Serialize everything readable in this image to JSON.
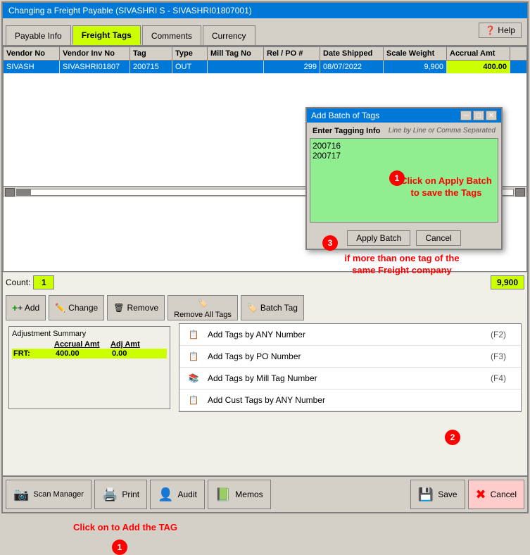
{
  "titleBar": {
    "text": "Changing a Freight Payable  (SIVASHRI S - SIVASHRI01807001)"
  },
  "tabs": [
    {
      "id": "payable-info",
      "label": "Payable Info",
      "active": false
    },
    {
      "id": "freight-tags",
      "label": "Freight Tags",
      "active": true
    },
    {
      "id": "comments",
      "label": "Comments",
      "active": false
    },
    {
      "id": "currency",
      "label": "Currency",
      "active": false
    }
  ],
  "helpBtn": "❓ Help",
  "table": {
    "headers": [
      "Vendor No",
      "Vendor Inv No",
      "Tag",
      "Type",
      "Mill Tag No",
      "Rel / PO #",
      "Date Shipped",
      "Scale Weight",
      "Accrual Amt"
    ],
    "rows": [
      {
        "vendorNo": "SIVASH",
        "vendorInvNo": "SIVASHRI01807",
        "tag": "200715",
        "type": "OUT",
        "millTagNo": "",
        "relPo": "299",
        "dateShipped": "08/07/2022",
        "scaleWeight": "9,900",
        "accrualAmt": "400.00",
        "selected": true
      }
    ]
  },
  "count": {
    "label": "Count:",
    "value": "1"
  },
  "total": "9,900",
  "buttons": {
    "add": "+ Add",
    "change": "Change",
    "remove": "Remove",
    "removeAll": "Remove All Tags",
    "batchTag": "Batch Tag"
  },
  "dropdownItems": [
    {
      "label": "Add Tags by ANY Number",
      "shortcut": "(F2)"
    },
    {
      "label": "Add Tags by PO Number",
      "shortcut": "(F3)"
    },
    {
      "label": "Add Tags by Mill Tag Number",
      "shortcut": "(F4)"
    },
    {
      "label": "Add Cust Tags by ANY Number",
      "shortcut": ""
    }
  ],
  "adjustmentSummary": {
    "title": "Adjustment Summary",
    "headers": [
      "",
      "Accrual Amt",
      "Adj Amt"
    ],
    "rows": [
      {
        "label": "FRT:",
        "accrual": "400.00",
        "adj": "0.00",
        "highlight": true
      }
    ]
  },
  "annotations": {
    "clickToAdd": "Click on to Add the TAG",
    "clickApply": "Click on Apply Batch to save the Tags",
    "moreTags": "if more than one tag of the same Freight company"
  },
  "modal": {
    "title": "Add Batch of Tags",
    "labelEnter": "Enter Tagging Info",
    "labelHint": "Line by Line or Comma Separated",
    "textareaContent": "200716\n200717",
    "applyBtn": "Apply Batch",
    "cancelBtn": "Cancel"
  },
  "footer": {
    "scanManager": "Scan Manager",
    "print": "Print",
    "audit": "Audit",
    "memos": "Memos",
    "save": "Save",
    "cancel": "Cancel"
  }
}
